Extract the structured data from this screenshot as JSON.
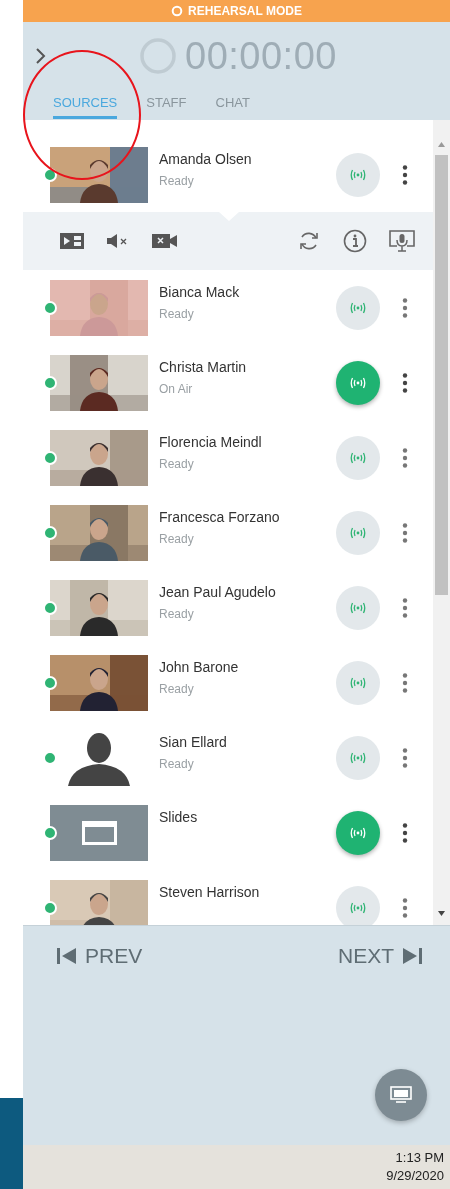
{
  "banner": {
    "label": "REHEARSAL MODE"
  },
  "header": {
    "timer": "00:00:00"
  },
  "tabs": [
    {
      "label": "SOURCES",
      "selected": true
    },
    {
      "label": "STAFF",
      "selected": false
    },
    {
      "label": "CHAT",
      "selected": false
    }
  ],
  "sources": [
    {
      "name": "Amanda Olsen",
      "status": "Ready",
      "on_air": false,
      "expanded": true,
      "kind": "picture"
    },
    {
      "name": "Bianca Mack",
      "status": "Ready",
      "on_air": false,
      "expanded": false,
      "kind": "picture"
    },
    {
      "name": "Christa Martin",
      "status": "On Air",
      "on_air": true,
      "expanded": false,
      "kind": "picture"
    },
    {
      "name": "Florencia Meindl",
      "status": "Ready",
      "on_air": false,
      "expanded": false,
      "kind": "picture"
    },
    {
      "name": "Francesca Forzano",
      "status": "Ready",
      "on_air": false,
      "expanded": false,
      "kind": "picture"
    },
    {
      "name": "Jean Paul Agudelo",
      "status": "Ready",
      "on_air": false,
      "expanded": false,
      "kind": "picture"
    },
    {
      "name": "John Barone",
      "status": "Ready",
      "on_air": false,
      "expanded": false,
      "kind": "picture"
    },
    {
      "name": "Sian Ellard",
      "status": "Ready",
      "on_air": false,
      "expanded": false,
      "kind": "silhouette"
    },
    {
      "name": "Slides",
      "on_air": true,
      "expanded": false,
      "kind": "screen"
    },
    {
      "name": "Steven Harrison",
      "on_air": false,
      "expanded": false,
      "kind": "picture"
    }
  ],
  "nav": {
    "prev": "PREV",
    "next": "NEXT"
  },
  "taskbar": {
    "time": "1:13 PM",
    "date": "9/29/2020"
  }
}
